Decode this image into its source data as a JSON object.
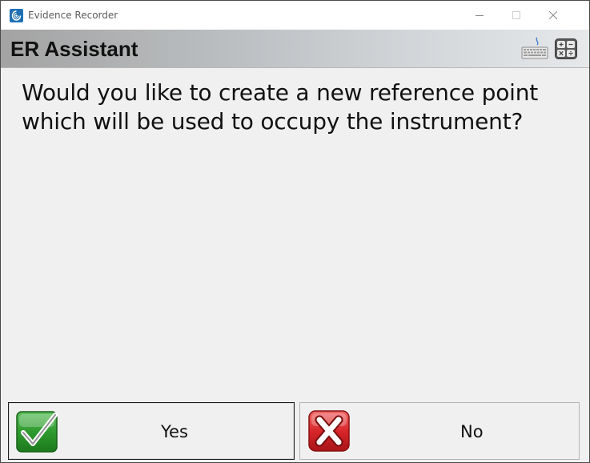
{
  "window": {
    "title": "Evidence Recorder",
    "controls": [
      "minimize-icon",
      "maximize-icon",
      "close-icon"
    ]
  },
  "header": {
    "title": "ER Assistant",
    "icons": [
      "keyboard-icon",
      "calculator-icon"
    ]
  },
  "dialog": {
    "message_line1": "Would you like to create a new reference point",
    "message_line2": "which will be used to occupy the instrument?"
  },
  "buttons": {
    "yes_label": "Yes",
    "no_label": "No"
  },
  "colors": {
    "yes_green": "#2e9a2e",
    "no_red": "#d8262a",
    "app_icon_blue": "#1f6fb5"
  }
}
